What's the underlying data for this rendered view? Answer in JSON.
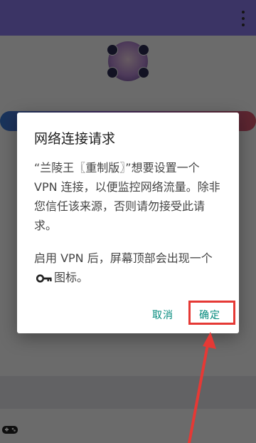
{
  "app": {
    "title": "",
    "subtitle": "",
    "bottom_button_label": "",
    "bottom_bar_text": ""
  },
  "dialog": {
    "title": "网络连接请求",
    "body_paragraph_1": "“兰陵王〖重制版〗”想要设置一个 VPN 连接，以便监控网络流量。除非您信任该来源，否则请勿接受此请求。",
    "body_paragraph_2_before_icon": "启用 VPN 后，屏幕顶部会出现一个",
    "body_paragraph_2_after_icon": "图标。",
    "inline_icon": "key-icon",
    "cancel_label": "取消",
    "ok_label": "确定"
  },
  "annotation": {
    "highlight_color": "#e53935",
    "arrow_color": "#e53935"
  },
  "colors": {
    "header": "#8e7df0",
    "button_text": "#00897b"
  },
  "icons": [
    "overflow-menu-icon",
    "avatar",
    "gamepad-icon",
    "key-icon"
  ]
}
